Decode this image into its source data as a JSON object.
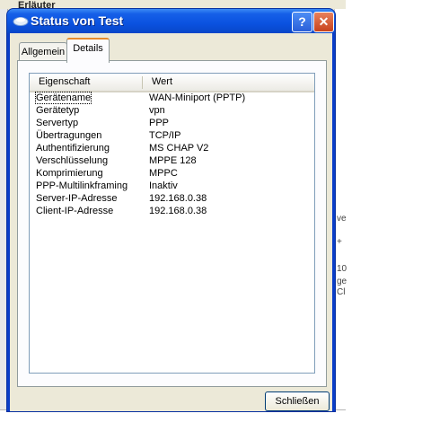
{
  "background": {
    "partial_title": "Erläuter",
    "fragments": [
      "ve",
      "+",
      "10",
      "ge",
      "Cl"
    ]
  },
  "dialog": {
    "title": "Status von Test",
    "help_symbol": "?",
    "close_symbol": "✕",
    "tabs": [
      {
        "label": "Allgemein",
        "active": false
      },
      {
        "label": "Details",
        "active": true
      }
    ],
    "list": {
      "columns": [
        "Eigenschaft",
        "Wert"
      ],
      "rows": [
        {
          "property": "Gerätename",
          "value": "WAN-Miniport (PPTP)"
        },
        {
          "property": "Gerätetyp",
          "value": "vpn"
        },
        {
          "property": "Servertyp",
          "value": "PPP"
        },
        {
          "property": "Übertragungen",
          "value": "TCP/IP"
        },
        {
          "property": "Authentifizierung",
          "value": "MS CHAP V2"
        },
        {
          "property": "Verschlüsselung",
          "value": "MPPE 128"
        },
        {
          "property": "Komprimierung",
          "value": "MPPC"
        },
        {
          "property": "PPP-Multilinkframing",
          "value": "Inaktiv"
        },
        {
          "property": "Server-IP-Adresse",
          "value": "192.168.0.38"
        },
        {
          "property": "Client-IP-Adresse",
          "value": "192.168.0.38"
        }
      ]
    },
    "close_button_label": "Schließen"
  },
  "colors": {
    "titlebar": "#0a52e0",
    "dialog_face": "#ece9d8",
    "active_tab_accent": "#e68b2c"
  }
}
